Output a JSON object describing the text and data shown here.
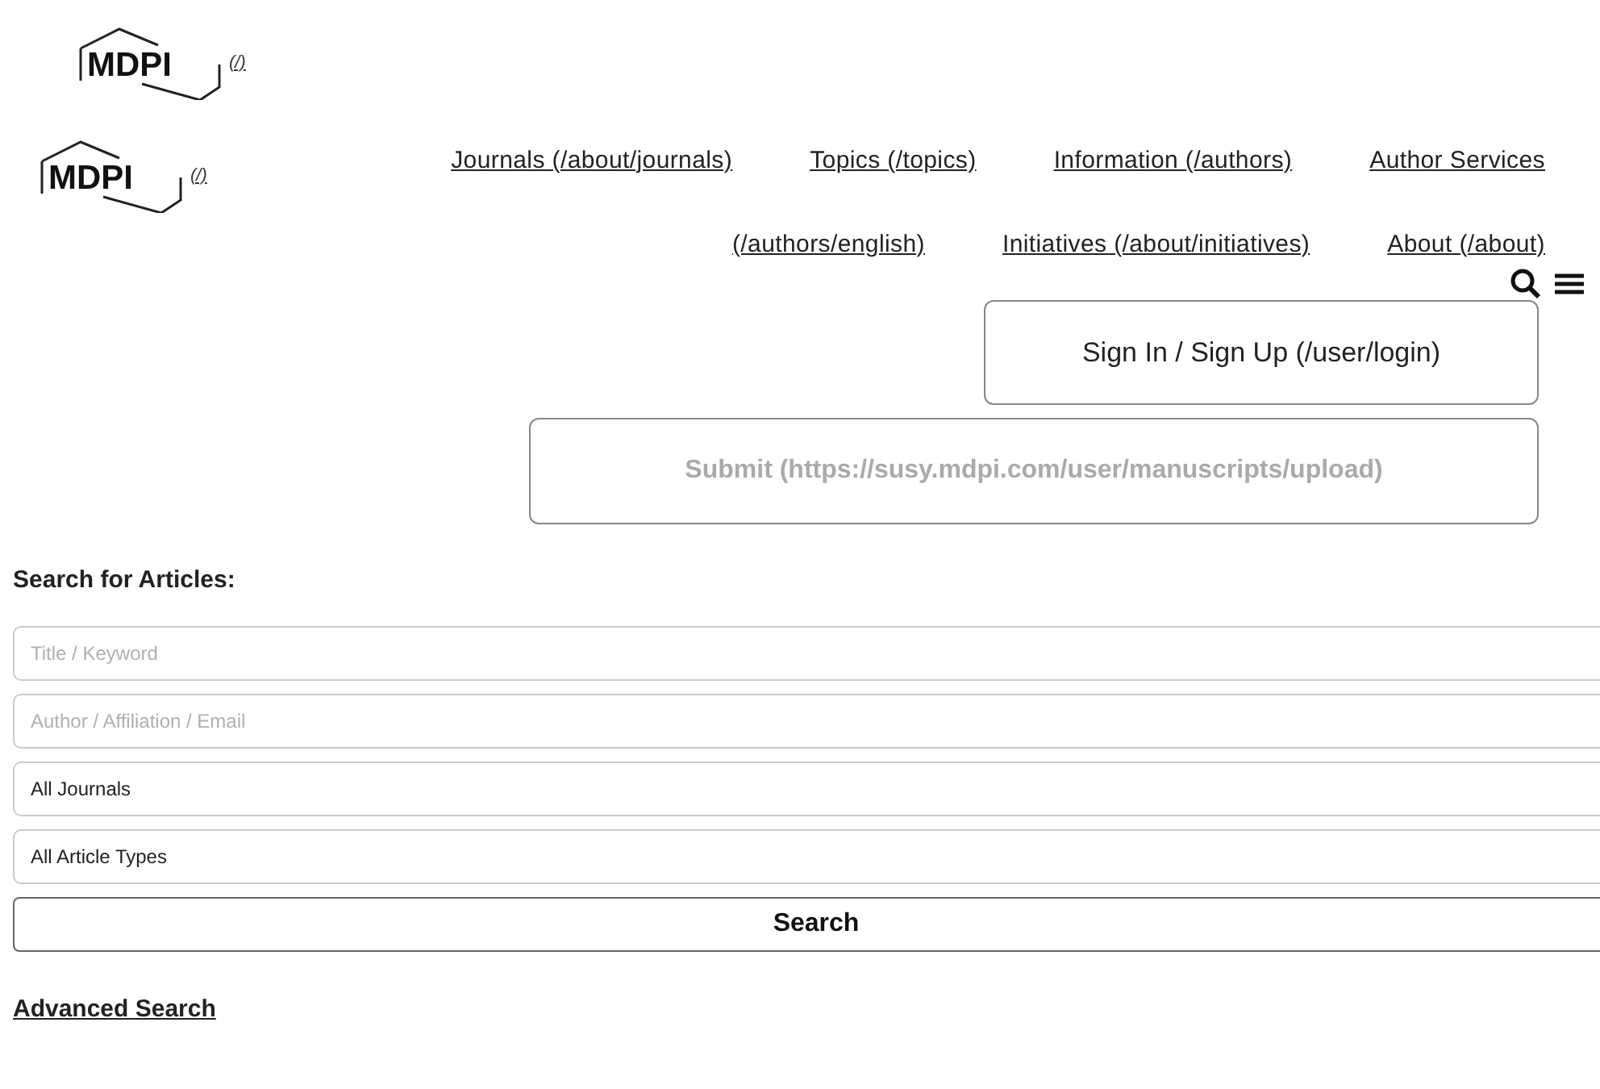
{
  "header": {
    "logo_text": "MDPI",
    "logo_link": "(/)"
  },
  "nav": {
    "logo_text": "MDPI",
    "logo_link": "(/)",
    "links": [
      {
        "label": "Journals (/about/journals)"
      },
      {
        "label": "Topics (/topics)"
      },
      {
        "label": "Information (/authors)"
      },
      {
        "label": "Author Services"
      },
      {
        "label": "(/authors/english)"
      },
      {
        "label": "Initiatives (/about/initiatives)"
      },
      {
        "label": "About (/about)"
      }
    ],
    "sign_in": "Sign In / Sign Up (/user/login)",
    "submit": {
      "label": "Submit (https://susy.mdpi.com/user/manuscripts/upload)",
      "disabled": true
    }
  },
  "search": {
    "title": "Search for Articles:",
    "fields": [
      {
        "kind": "input",
        "placeholder": "Title / Keyword"
      },
      {
        "kind": "input",
        "placeholder": "Author / Affiliation / Email"
      },
      {
        "kind": "select",
        "value": "All Journals"
      },
      {
        "kind": "select",
        "value": "All Article Types"
      }
    ],
    "button": "Search",
    "advanced": "Advanced Search"
  }
}
